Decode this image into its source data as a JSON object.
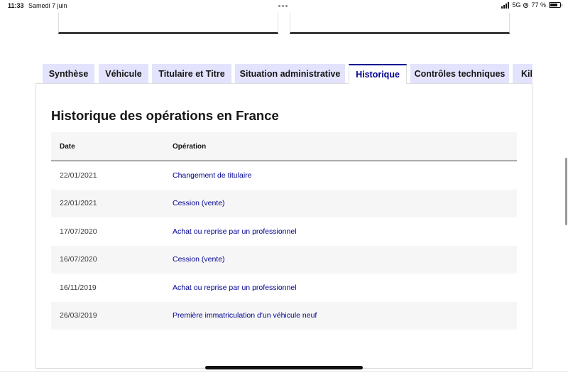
{
  "status_bar": {
    "time": "11:33",
    "date": "Samedi 7 juin",
    "network": "5G",
    "battery": "77 %"
  },
  "tabs": [
    {
      "label": "Synthèse",
      "active": false
    },
    {
      "label": "Véhicule",
      "active": false
    },
    {
      "label": "Titulaire et Titre",
      "active": false
    },
    {
      "label": "Situation administrative",
      "active": false
    },
    {
      "label": "Historique",
      "active": true
    },
    {
      "label": "Contrôles techniques",
      "active": false
    },
    {
      "label": "Kilo",
      "active": false
    }
  ],
  "section": {
    "title": "Historique des opérations en France"
  },
  "table": {
    "headers": [
      "Date",
      "Opération"
    ],
    "rows": [
      {
        "date": "22/01/2021",
        "operation": "Changement de titulaire"
      },
      {
        "date": "22/01/2021",
        "operation": "Cession (vente)"
      },
      {
        "date": "17/07/2020",
        "operation": "Achat ou reprise par un professionnel"
      },
      {
        "date": "16/07/2020",
        "operation": "Cession (vente)"
      },
      {
        "date": "16/11/2019",
        "operation": "Achat ou reprise par un professionnel"
      },
      {
        "date": "26/03/2019",
        "operation": "Première immatriculation d'un véhicule neuf"
      }
    ]
  },
  "colors": {
    "accent": "#000091",
    "tab_background": "#e3e3fd",
    "stripe": "#f6f6f6"
  }
}
